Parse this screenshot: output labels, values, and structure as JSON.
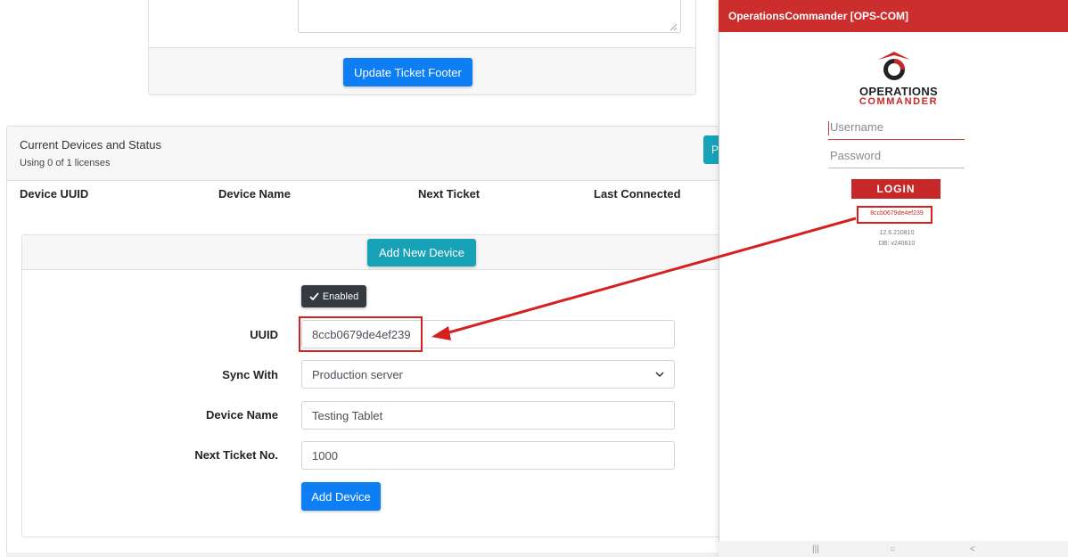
{
  "footer_section": {
    "update_button_label": "Update Ticket Footer"
  },
  "devices_section": {
    "title": "Current Devices and Status",
    "license_usage": "Using 0 of 1 licenses",
    "partial_button_label": "P",
    "columns": [
      "Device UUID",
      "Device Name",
      "Next Ticket",
      "Last Connected"
    ]
  },
  "add_device_form": {
    "add_new_button_label": "Add New Device",
    "enabled_label": "Enabled",
    "uuid_label": "UUID",
    "uuid_value": "8ccb0679de4ef239",
    "sync_label": "Sync With",
    "sync_selected": "Production server",
    "name_label": "Device Name",
    "name_value": "Testing Tablet",
    "next_label": "Next Ticket No.",
    "next_value": "1000",
    "submit_label": "Add Device"
  },
  "tablet_app": {
    "title_bar": "OperationsCommander [OPS-COM]",
    "brand_line1": "OPERATIONS",
    "brand_line2": "COMMANDER",
    "username_placeholder": "Username",
    "password_placeholder": "Password",
    "login_label": "LOGIN",
    "device_uuid": "8ccb0679de4ef239",
    "version": "12.6.210810",
    "db_version": "DB: v240610",
    "nav": [
      "|||",
      "○",
      "<"
    ]
  },
  "colors": {
    "primary": "#0d7ef3",
    "info": "#17a2b8",
    "brand_red": "#c62828",
    "annotation_red": "#d61f1f"
  }
}
